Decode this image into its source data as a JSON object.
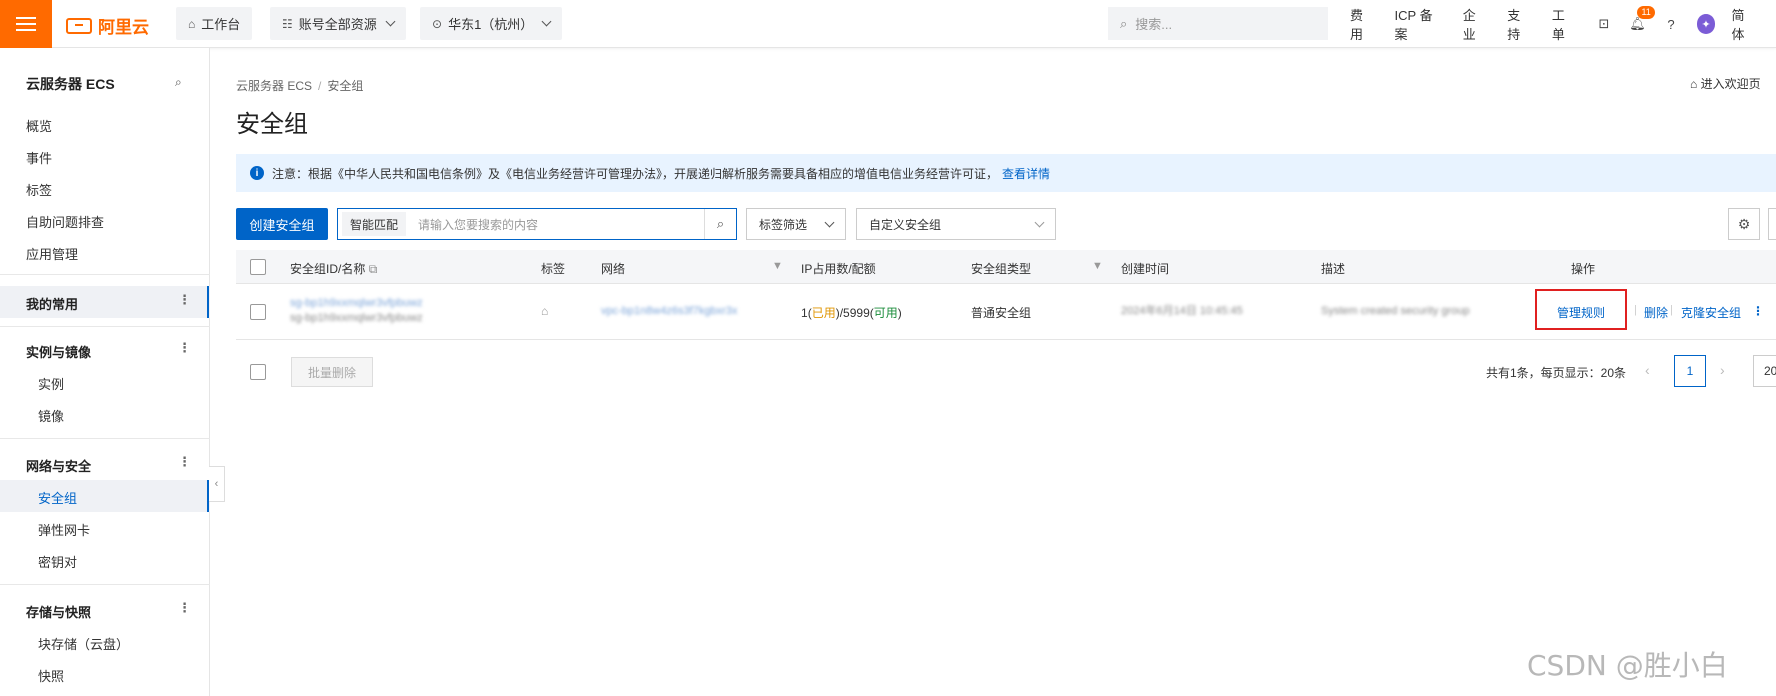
{
  "topbar": {
    "logo": "阿里云",
    "workbench": "工作台",
    "account_resources": "账号全部资源",
    "region": "华东1（杭州）",
    "search_placeholder": "搜索...",
    "links": [
      "费用",
      "ICP 备案",
      "企业",
      "支持",
      "工单"
    ],
    "notification_count": "11",
    "language": "简体"
  },
  "sidebar": {
    "title": "云服务器 ECS",
    "top_items": [
      "概览",
      "事件",
      "标签",
      "自助问题排查",
      "应用管理"
    ],
    "favorites": "我的常用",
    "groups": [
      {
        "label": "实例与镜像",
        "items": [
          "实例",
          "镜像"
        ]
      },
      {
        "label": "网络与安全",
        "items": [
          "安全组",
          "弹性网卡",
          "密钥对"
        ]
      },
      {
        "label": "存储与快照",
        "items": [
          "块存储（云盘）",
          "快照"
        ]
      }
    ]
  },
  "main": {
    "breadcrumb": [
      "云服务器 ECS",
      "安全组"
    ],
    "welcome_link": "进入欢迎页",
    "page_title": "安全组",
    "notice": {
      "text": "注意：根据《中华人民共和国电信条例》及《电信业务经营许可管理办法》，开展递归解析服务需要具备相应的增值电信业务经营许可证，",
      "link": "查看详情"
    },
    "create_button": "创建安全组",
    "search_mode": "智能匹配",
    "search_placeholder": "请输入您要搜索的内容",
    "tag_filter": "标签筛选",
    "group_filter": "自定义安全组"
  },
  "table": {
    "headers": [
      "安全组ID/名称",
      "标签",
      "网络",
      "IP占用数/配额",
      "安全组类型",
      "创建时间",
      "描述",
      "操作"
    ],
    "row": {
      "id_line1": "sg-bp1h9xxmqlwr3vfpbuwz",
      "id_line2": "sg-bp1h9xxmqlwr3vfpbuwz",
      "network": "vpc-bp1n8w4z6s3f7kgbxr3x",
      "ip_used_count": "1",
      "ip_used_label": "已用",
      "ip_quota": "5999",
      "ip_avail_label": "可用",
      "type": "普通安全组",
      "created": "2024年6月14日 10:45:45",
      "description": "System created security group",
      "actions": [
        "管理规则",
        "删除",
        "克隆安全组"
      ]
    },
    "bulk_delete": "批量删除",
    "pagination": {
      "summary": "共有1条，每页显示：20条",
      "current_page": "1",
      "page_size": "20"
    }
  },
  "watermark": "CSDN @胜小白"
}
